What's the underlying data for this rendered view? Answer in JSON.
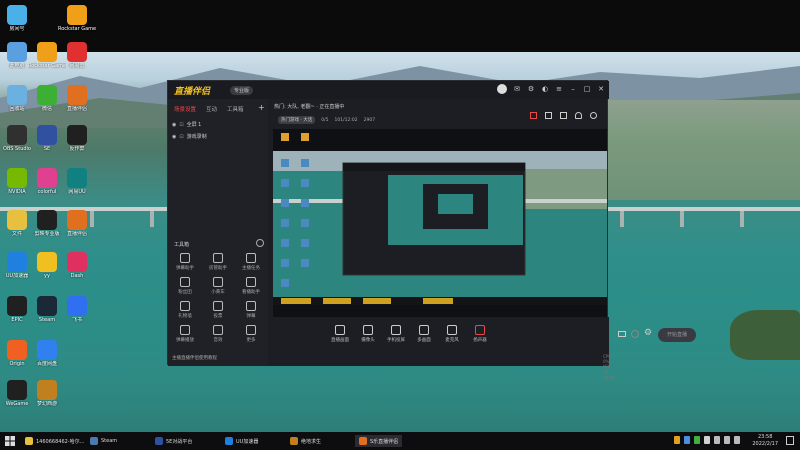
{
  "desktop": {
    "icons": [
      {
        "label": "房间号",
        "icon": "computer-icon",
        "color": "#4ab0e8"
      },
      {
        "label": "Rockstar Games L...",
        "icon": "rockstar-icon",
        "color": "#f0a018"
      },
      {
        "label": "此电脑",
        "icon": "pc-icon",
        "color": "#5aa0e0"
      },
      {
        "label": "Rockstar Games...",
        "icon": "rockstar-icon",
        "color": "#f0a018"
      },
      {
        "label": "网易云",
        "icon": "netease-icon",
        "color": "#e03030"
      },
      {
        "label": "回收站",
        "icon": "recycle-icon",
        "color": "#6ab0e0"
      },
      {
        "label": "微信",
        "icon": "wechat-icon",
        "color": "#3cb034"
      },
      {
        "label": "直播伴侣",
        "icon": "app-icon",
        "color": "#e07020"
      },
      {
        "label": "OBS Studio",
        "icon": "obs-icon",
        "color": "#303030"
      },
      {
        "label": "SE",
        "icon": "se-icon",
        "color": "#3050a0"
      },
      {
        "label": "反作弊",
        "icon": "shield-icon",
        "color": "#202020"
      },
      {
        "label": "NVIDIA",
        "icon": "nvidia-icon",
        "color": "#76b900"
      },
      {
        "label": "colorful",
        "icon": "color-icon",
        "color": "#e04090"
      },
      {
        "label": "网易UU",
        "icon": "uu-icon",
        "color": "#108080"
      },
      {
        "label": "文件",
        "icon": "folder-icon",
        "color": "#e8c040"
      },
      {
        "label": "剪映专业版",
        "icon": "capcut-icon",
        "color": "#202020"
      },
      {
        "label": "直播伴侣",
        "icon": "app-icon",
        "color": "#e07020"
      },
      {
        "label": "UU加速器",
        "icon": "uu-icon",
        "color": "#2080e0"
      },
      {
        "label": "yy",
        "icon": "yy-icon",
        "color": "#f0c020"
      },
      {
        "label": "Dash",
        "icon": "dash-icon",
        "color": "#e03060"
      },
      {
        "label": "EPIC",
        "icon": "epic-icon",
        "color": "#202020"
      },
      {
        "label": "Steam",
        "icon": "steam-icon",
        "color": "#1b2838"
      },
      {
        "label": "飞书",
        "icon": "feishu-icon",
        "color": "#3070f0"
      },
      {
        "label": "Origin",
        "icon": "origin-icon",
        "color": "#f06020"
      },
      {
        "label": "百度网盘",
        "icon": "cloud-icon",
        "color": "#3080f0"
      },
      {
        "label": "WeGame",
        "icon": "wegame-icon",
        "color": "#202020"
      },
      {
        "label": "梦幻西游",
        "icon": "game-icon",
        "color": "#c08020"
      }
    ]
  },
  "app": {
    "title_logo": "直播伴侣",
    "badge": "专业版",
    "left_tabs": [
      "场景设置",
      "互动",
      "工具箱"
    ],
    "scenes": [
      "全屏 1",
      "游戏录制"
    ],
    "toolbox_title": "工具箱",
    "tools": [
      "弹幕助手",
      "房管助手",
      "主播任务",
      "粉丝团",
      "小黄车",
      "看播助手",
      "礼物墙",
      "投票",
      "弹幕",
      "弹幕播放",
      "音效",
      "更多"
    ],
    "footer": "主播直播伴侣使用教程",
    "top_info": "热门: 大队, 老翻~ · 正在直播中",
    "info_tags": [
      "热门游戏 · 大话",
      "0/5",
      "101/12:02",
      "2907"
    ],
    "controls": [
      "直播画面",
      "摄像头",
      "手机投屏",
      "多画面",
      "麦克风",
      "扬声器"
    ],
    "go_live": "开始直播",
    "status": "CPU 0%  帧率 30  00:00"
  },
  "taskbar": {
    "items": [
      {
        "label": "1460668462-哈尔...",
        "icon": "folder-icon",
        "color": "#e8c040"
      },
      {
        "label": "Steam",
        "icon": "steam-icon",
        "color": "#4a7ab0"
      },
      {
        "label": "5E对战平台",
        "icon": "5e-icon",
        "color": "#3050a0"
      },
      {
        "label": "UU加速器",
        "icon": "uu-icon",
        "color": "#2080e0"
      },
      {
        "label": "绝地求生",
        "icon": "pubg-icon",
        "color": "#c08020"
      },
      {
        "label": "S乐直播伴侣",
        "icon": "app-icon",
        "color": "#e07020"
      }
    ],
    "time": "23:58",
    "date": "2022/2/17"
  }
}
